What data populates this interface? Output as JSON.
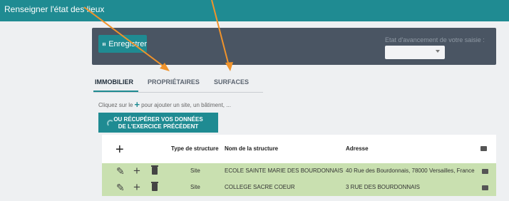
{
  "header": {
    "title": "Renseigner l'état des lieux"
  },
  "toolbar": {
    "save_label": "Enregistrer",
    "progress_label": "Etat d'avancement de votre saisie :",
    "progress_value": ""
  },
  "tabs": [
    {
      "label": "IMMOBILIER",
      "active": true
    },
    {
      "label": "PROPRIÉTAIRES",
      "active": false
    },
    {
      "label": "SURFACES",
      "active": false
    }
  ],
  "hint": {
    "before": "Cliquez sur le",
    "after": "pour ajouter un site, un bâtiment, ..."
  },
  "recover": {
    "line1": "OU RÉCUPÉRER VOS DONNÉES",
    "line2": "DE L'EXERCICE PRÉCÉDENT"
  },
  "table": {
    "headers": {
      "type": "Type de structure",
      "name": "Nom de la structure",
      "address": "Adresse"
    },
    "rows": [
      {
        "type": "Site",
        "name": "ECOLE SAINTE MARIE DES BOURDONNAIS",
        "address": "40 Rue des Bourdonnais, 78000 Versailles, France"
      },
      {
        "type": "Site",
        "name": "COLLEGE SACRE COEUR",
        "address": "3 RUE DES BOURDONNAIS"
      }
    ]
  },
  "colors": {
    "accent": "#1f8b92",
    "panel": "#4a5563",
    "row": "#c9e0b0",
    "annotation": "#f0932b"
  }
}
